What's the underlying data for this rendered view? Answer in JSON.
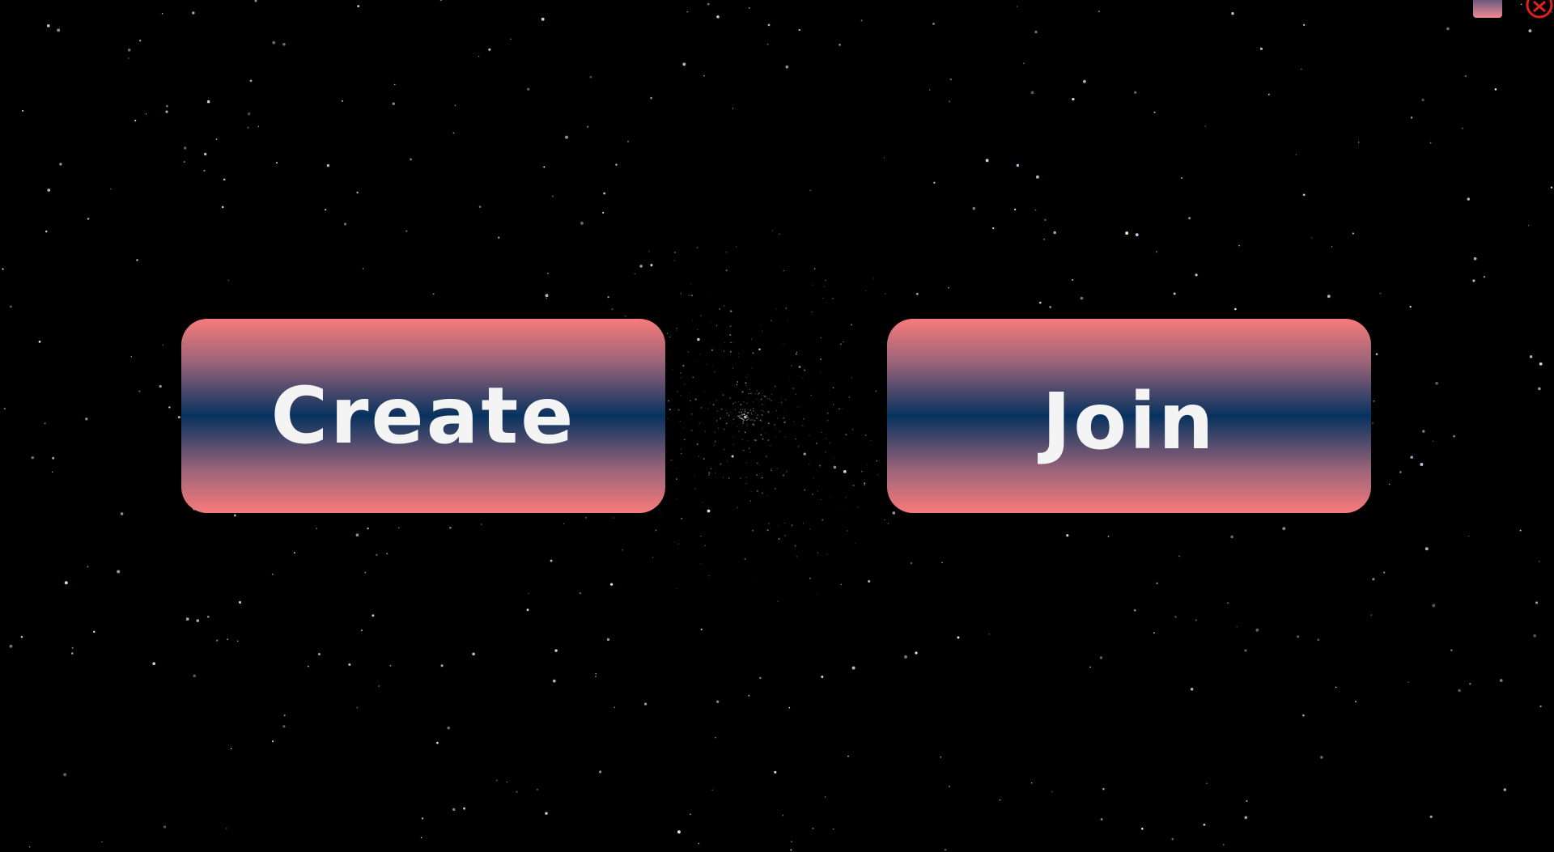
{
  "menu": {
    "create_label": "Create",
    "join_label": "Join"
  },
  "colors": {
    "background": "#000000",
    "button_edge": "#f77b7b",
    "button_center": "#07325f",
    "button_text": "#f4f4f4",
    "close_icon": "#e02020"
  },
  "icons": {
    "minimize": "minimize-icon",
    "close": "close-icon"
  }
}
